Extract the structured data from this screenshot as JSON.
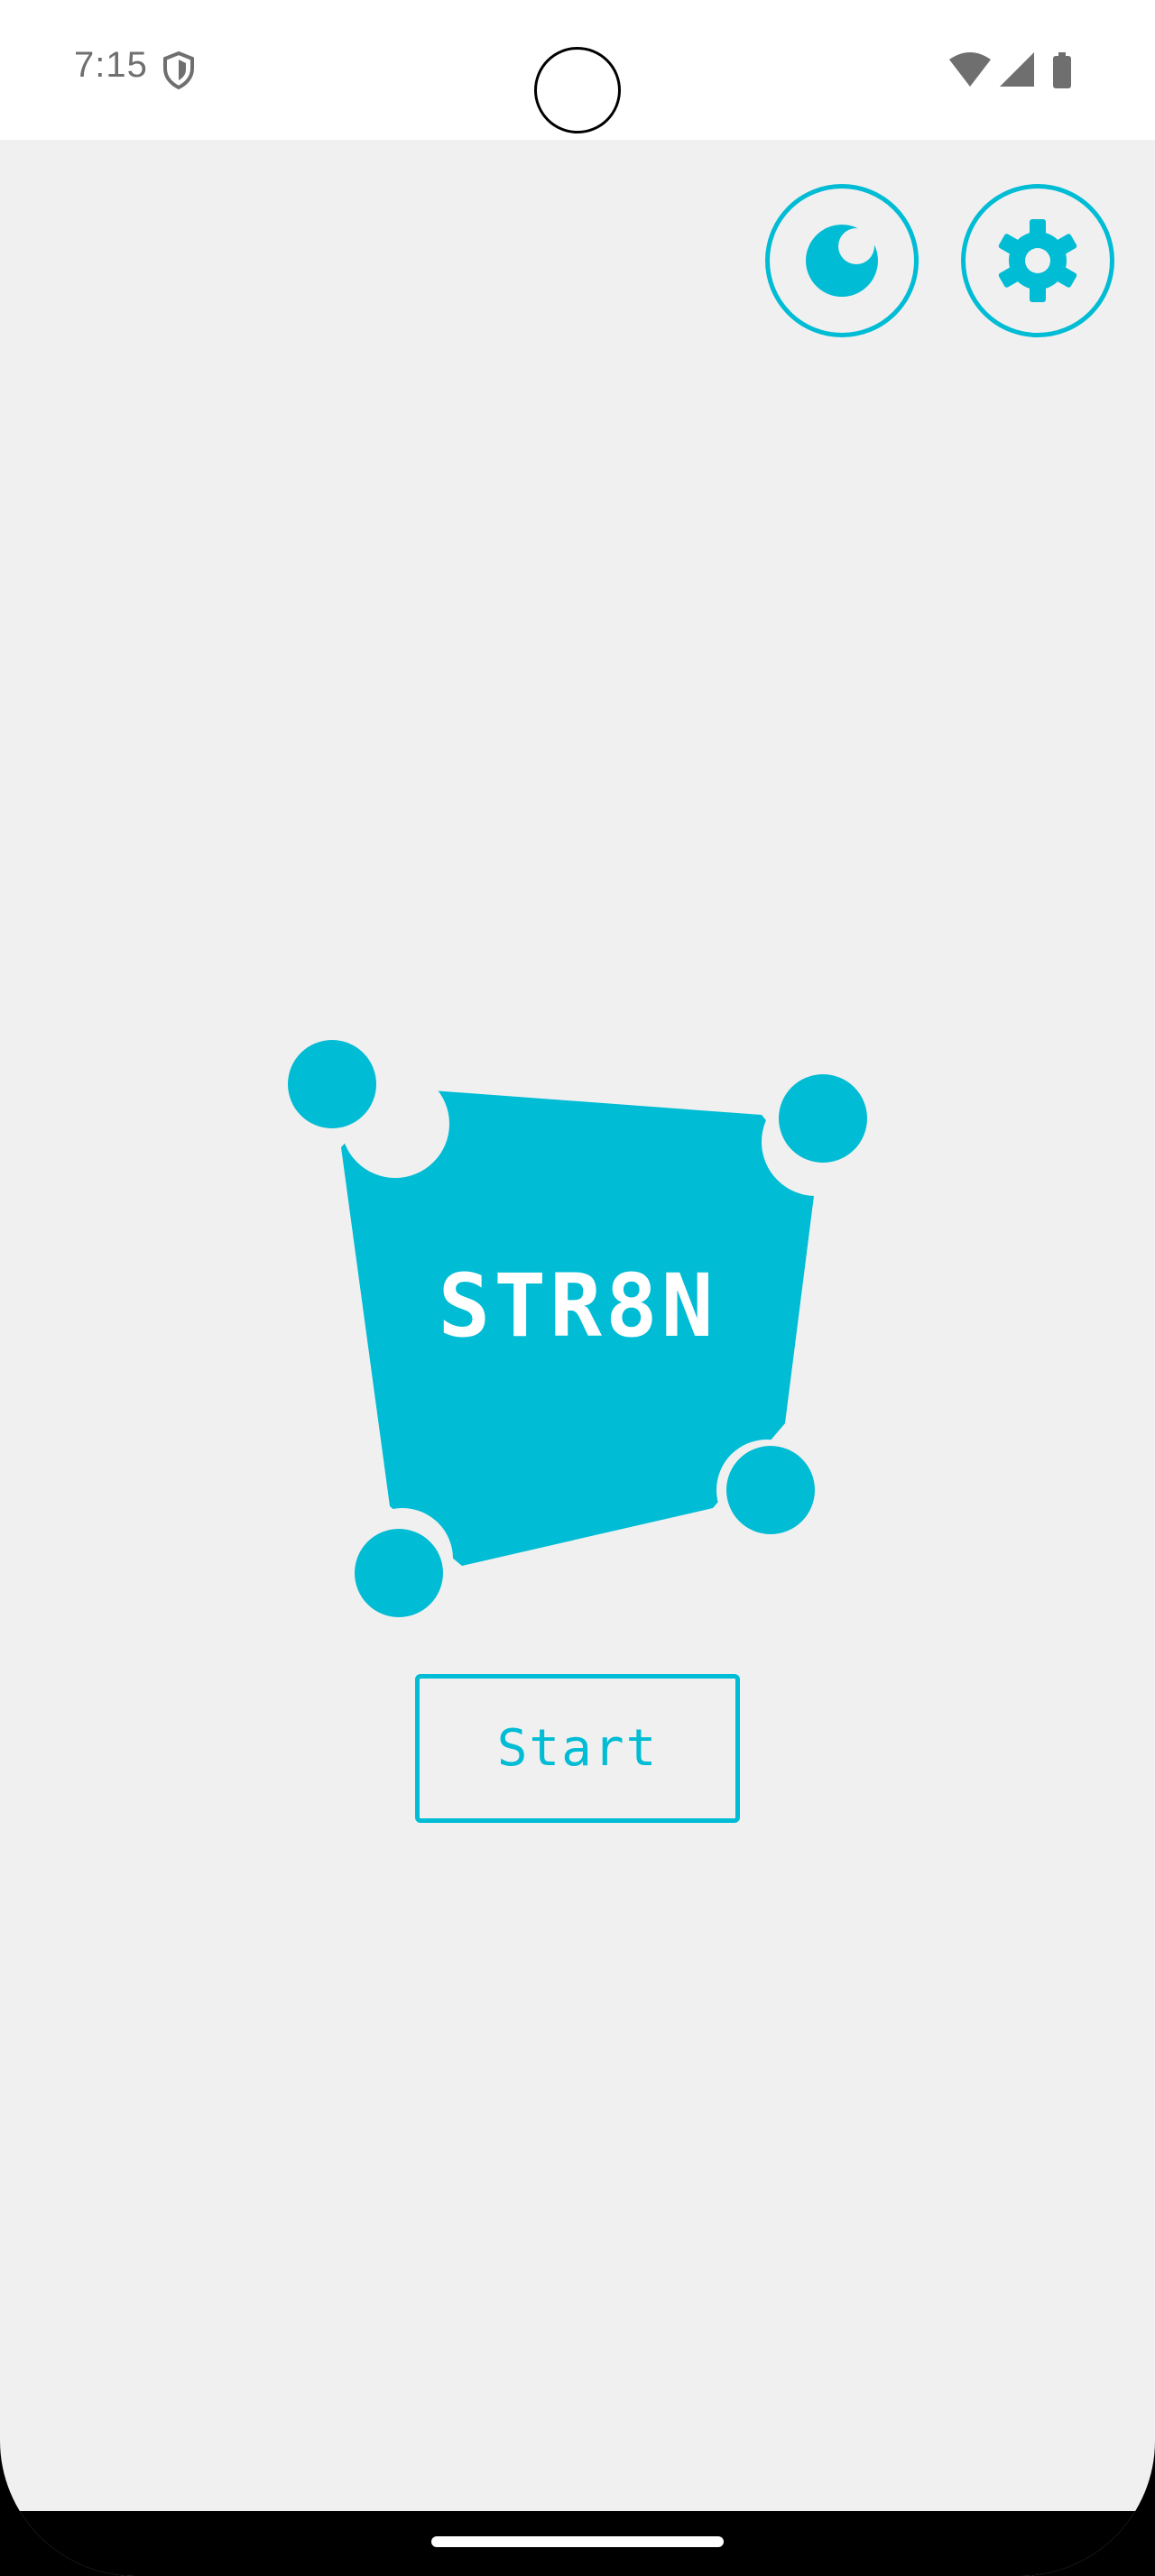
{
  "status_bar": {
    "time": "7:15",
    "left_icons": [
      "shield-icon"
    ],
    "right_icons": [
      "wifi-icon",
      "signal-icon",
      "battery-icon"
    ]
  },
  "toolbar": {
    "buttons": [
      {
        "icon": "moon-icon",
        "label": "theme toggle"
      },
      {
        "icon": "gear-icon",
        "label": "settings"
      }
    ]
  },
  "logo": {
    "title": "STR8N"
  },
  "start_button": {
    "label": "Start"
  },
  "colors": {
    "accent": "#00bcd4",
    "background": "#f0f0f0",
    "status_bar": "#ffffff",
    "status_text": "#6f6f6f",
    "nav_bar": "#000000"
  }
}
